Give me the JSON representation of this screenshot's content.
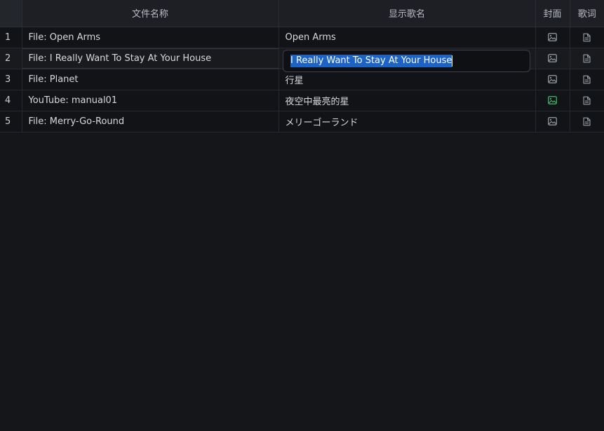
{
  "headers": {
    "index": "",
    "file_name": "文件名称",
    "display_name": "显示歌名",
    "cover": "封面",
    "lyrics": "歌词"
  },
  "rows": [
    {
      "index": "1",
      "file": "File: Open Arms",
      "display": "Open Arms",
      "cover_icon": "image-icon",
      "lyrics_icon": "document-icon",
      "cover_set": false
    },
    {
      "index": "2",
      "file": "File: I Really Want To Stay At Your House",
      "display": "",
      "cover_icon": "image-icon",
      "lyrics_icon": "document-icon",
      "cover_set": false
    },
    {
      "index": "3",
      "file": "File: Planet",
      "display": "行星",
      "cover_icon": "image-icon",
      "lyrics_icon": "document-icon",
      "cover_set": false
    },
    {
      "index": "4",
      "file": "YouTube: manual01",
      "display": "夜空中最亮的星",
      "cover_icon": "image-icon",
      "lyrics_icon": "document-icon",
      "cover_set": true
    },
    {
      "index": "5",
      "file": "File: Merry-Go-Round",
      "display": "メリーゴーランド",
      "cover_icon": "image-icon",
      "lyrics_icon": "document-icon",
      "cover_set": false
    }
  ],
  "editor": {
    "row": 2,
    "value": "I Really Want To Stay At Your House"
  },
  "colors": {
    "icon_default": "#9aa0a8",
    "icon_active": "#3fbf6e",
    "selection": "#1d63c4"
  }
}
